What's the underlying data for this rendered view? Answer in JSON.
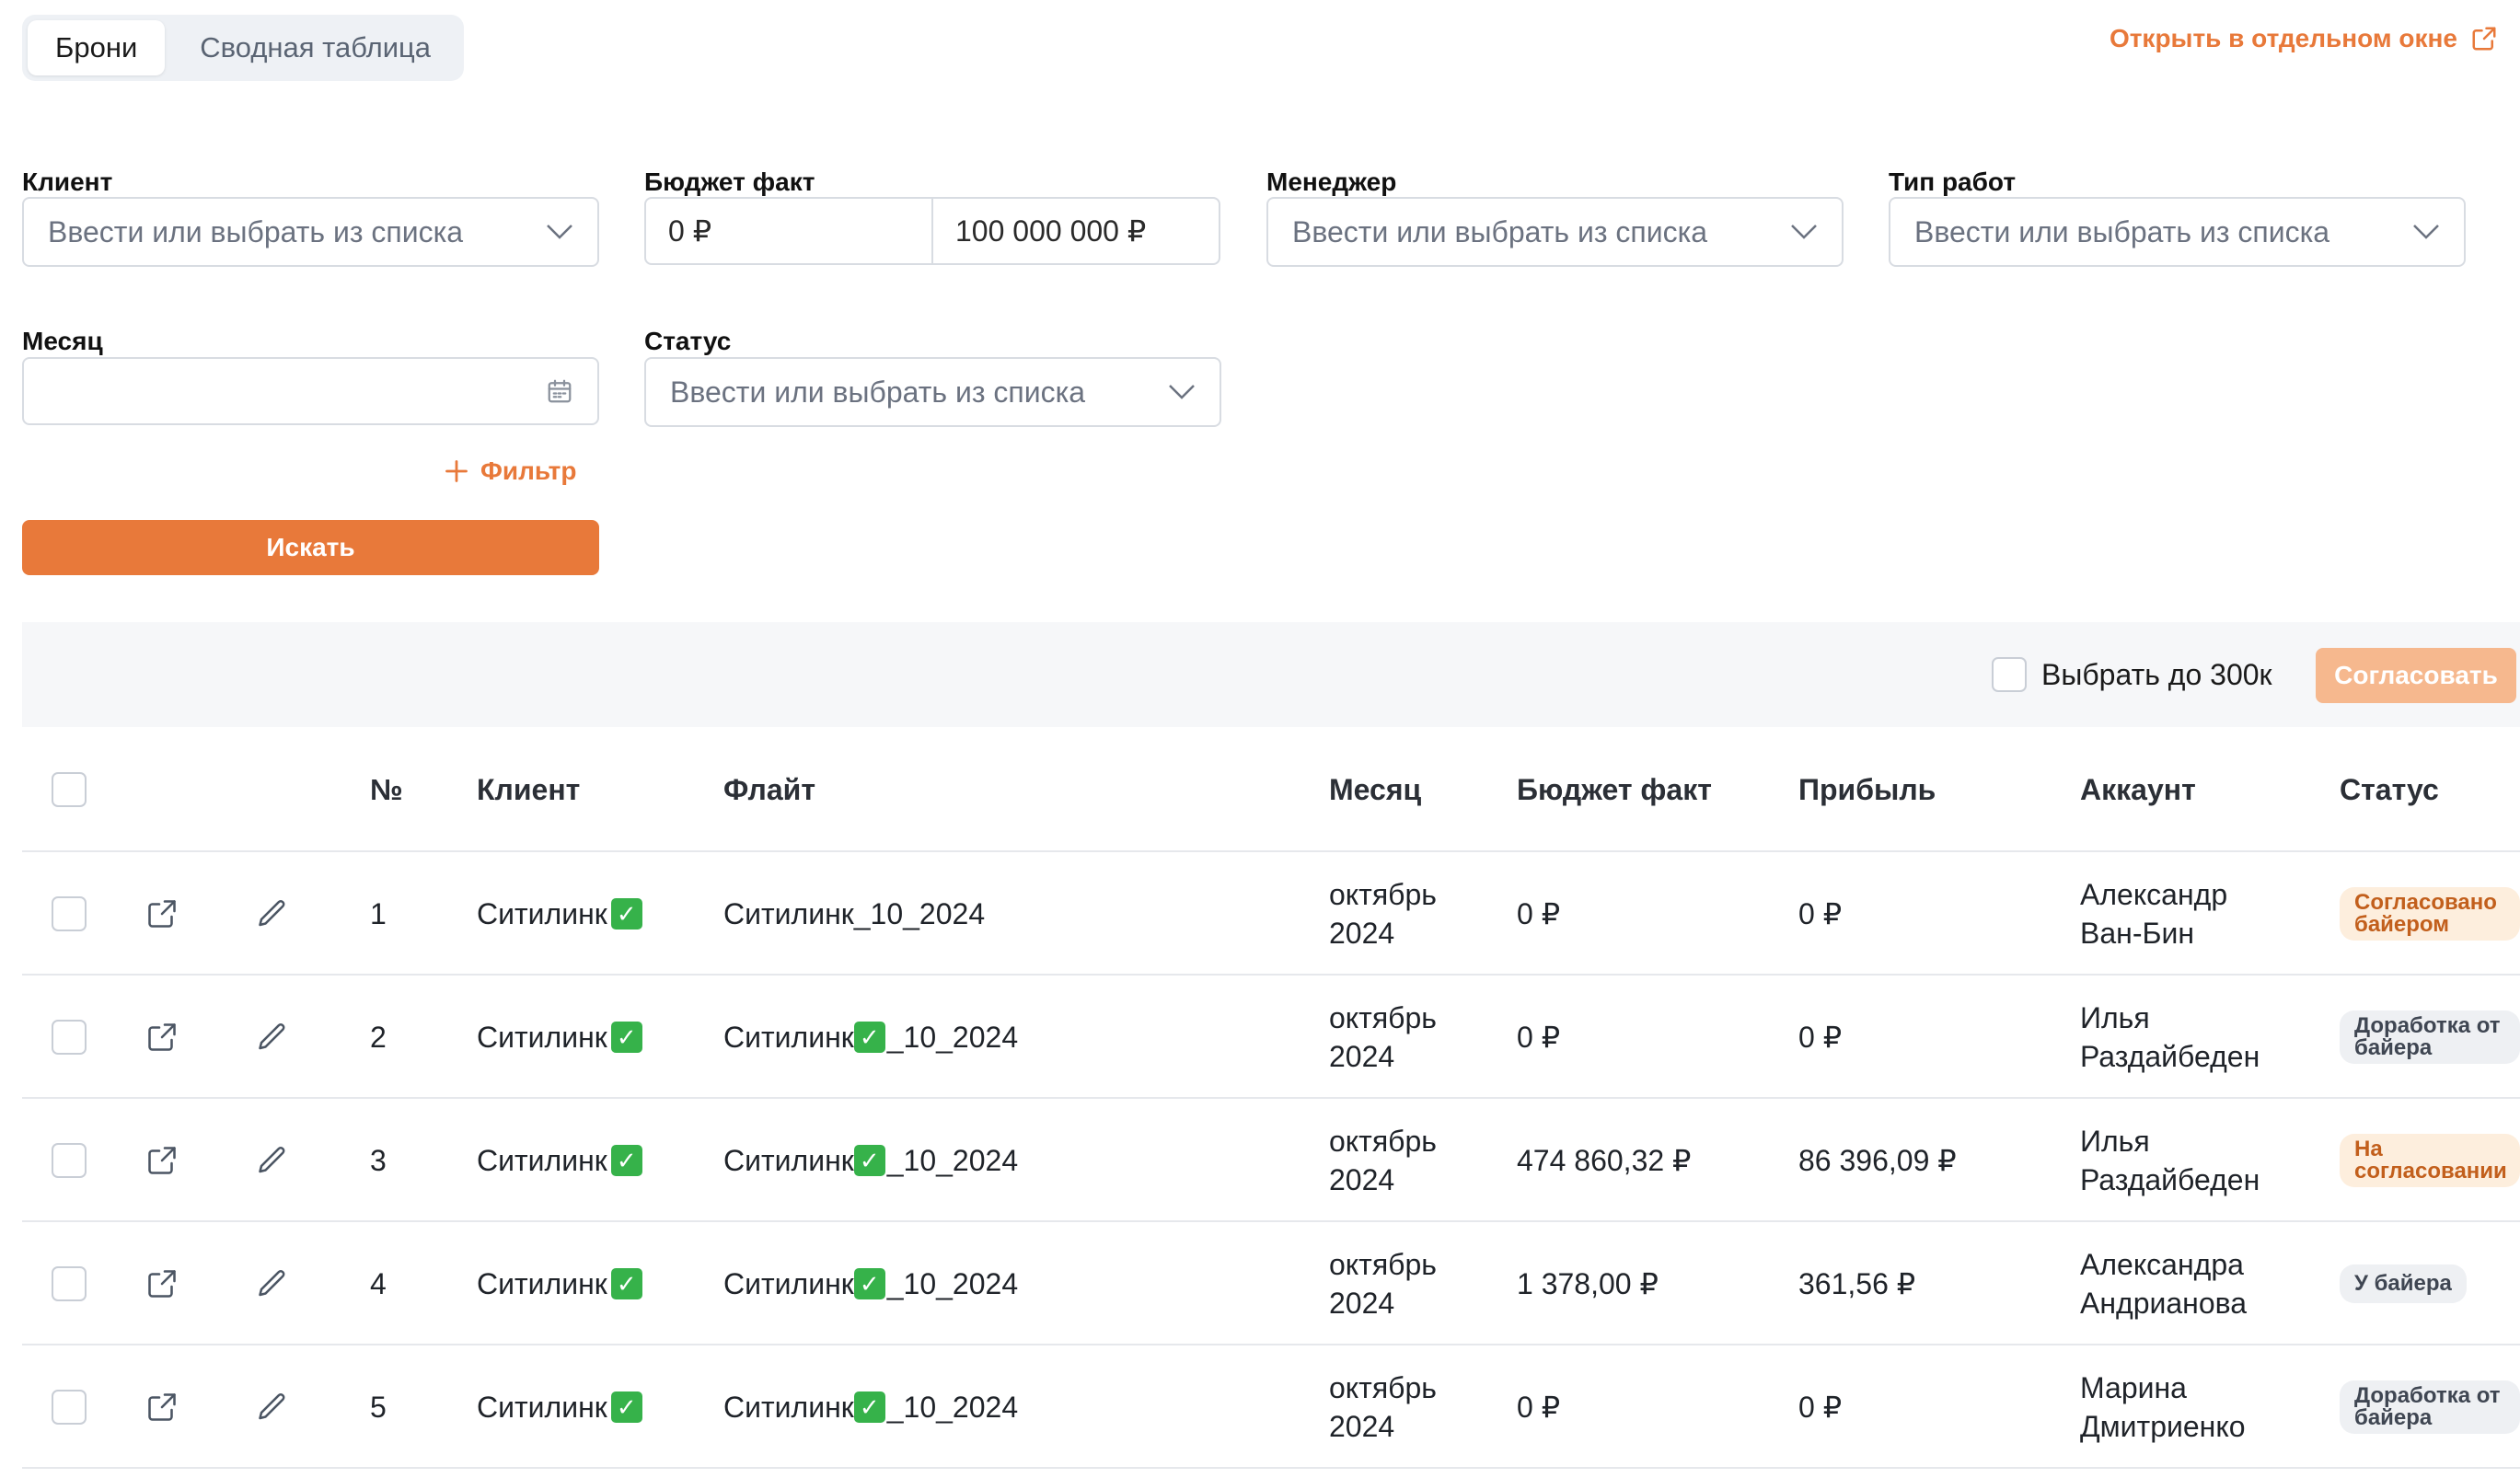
{
  "tabs": [
    {
      "label": "Брони",
      "active": true
    },
    {
      "label": "Сводная таблица",
      "active": false
    }
  ],
  "open_window_label": "Открыть в отдельном окне",
  "filters": {
    "client": {
      "label": "Клиент",
      "placeholder": "Ввести или выбрать из списка"
    },
    "budget": {
      "label": "Бюджет факт",
      "from": "0 ₽",
      "to": "100 000 000 ₽"
    },
    "manager": {
      "label": "Менеджер",
      "placeholder": "Ввести или выбрать из списка"
    },
    "work_type": {
      "label": "Тип работ",
      "placeholder": "Ввести или выбрать из списка"
    },
    "month": {
      "label": "Месяц",
      "value": ""
    },
    "status": {
      "label": "Статус",
      "placeholder": "Ввести или выбрать из списка"
    },
    "add_filter_label": "Фильтр",
    "search_label": "Искать"
  },
  "toolbar": {
    "select_up_to_label": "Выбрать до 300к",
    "approve_label": "Согласовать"
  },
  "table": {
    "columns": {
      "num": "№",
      "client": "Клиент",
      "flight": "Флайт",
      "month": "Месяц",
      "budget": "Бюджет факт",
      "profit": "Прибыль",
      "account": "Аккаунт",
      "status": "Статус"
    },
    "rows": [
      {
        "num": "1",
        "client": "Ситилинк",
        "flight_prefix": "Ситилинк",
        "flight_check": false,
        "flight_suffix": " _10_2024",
        "month": "октябрь 2024",
        "budget": "0 ₽",
        "profit": "0 ₽",
        "account": "Александр Ван-Бин",
        "status": "Согласовано байером",
        "status_color": "orange"
      },
      {
        "num": "2",
        "client": "Ситилинк",
        "flight_prefix": "Ситилинк ",
        "flight_check": true,
        "flight_suffix": "_10_2024",
        "month": "октябрь 2024",
        "budget": "0 ₽",
        "profit": "0 ₽",
        "account": "Илья Раздайбеден",
        "status": "Доработка от байера",
        "status_color": "gray"
      },
      {
        "num": "3",
        "client": "Ситилинк",
        "flight_prefix": "Ситилинк ",
        "flight_check": true,
        "flight_suffix": "_10_2024",
        "month": "октябрь 2024",
        "budget": "474 860,32 ₽",
        "profit": "86 396,09 ₽",
        "account": "Илья Раздайбеден",
        "status": "На согласовании",
        "status_color": "orange"
      },
      {
        "num": "4",
        "client": "Ситилинк",
        "flight_prefix": "Ситилинк ",
        "flight_check": true,
        "flight_suffix": "_10_2024",
        "month": "октябрь 2024",
        "budget": "1 378,00 ₽",
        "profit": "361,56 ₽",
        "account": "Александра Андрианова",
        "status": "У байера",
        "status_color": "gray"
      },
      {
        "num": "5",
        "client": "Ситилинк",
        "flight_prefix": "Ситилинк ",
        "flight_check": true,
        "flight_suffix": "_10_2024",
        "month": "октябрь 2024",
        "budget": "0 ₽",
        "profit": "0 ₽",
        "account": "Марина Дмитриенко",
        "status": "Доработка от байера",
        "status_color": "gray"
      }
    ]
  },
  "colors": {
    "accent": "#e8793a",
    "accent_disabled": "#f6b88e",
    "check_green": "#36b24a"
  }
}
